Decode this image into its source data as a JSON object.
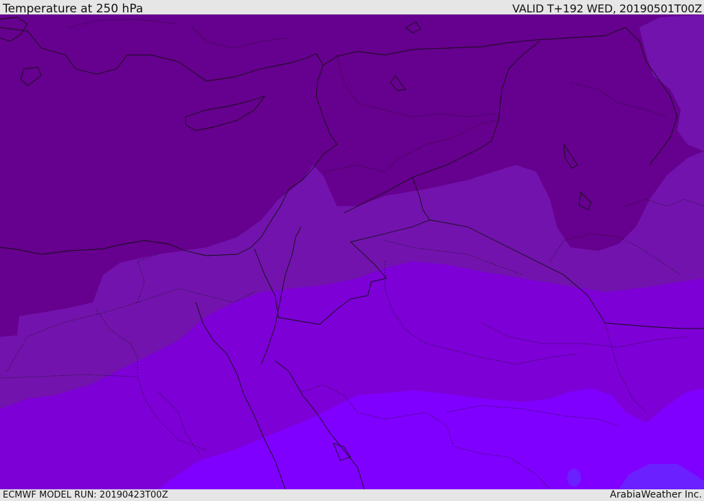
{
  "header": {
    "title": "Temperature at 250 hPa",
    "valid": "VALID T+192 WED, 20190501T00Z"
  },
  "footer": {
    "model_run": "ECMWF MODEL RUN: 20190423T00Z",
    "credit": "ArabiaWeather Inc."
  },
  "map": {
    "fill_levels": [
      {
        "name": "coldest",
        "color": "#66008e"
      },
      {
        "name": "cold",
        "color": "#7213ad"
      },
      {
        "name": "cool",
        "color": "#7d00d6"
      },
      {
        "name": "mild",
        "color": "#8000ff"
      },
      {
        "name": "warm",
        "color": "#6a20ff"
      }
    ],
    "boundary_color": "#111111"
  }
}
